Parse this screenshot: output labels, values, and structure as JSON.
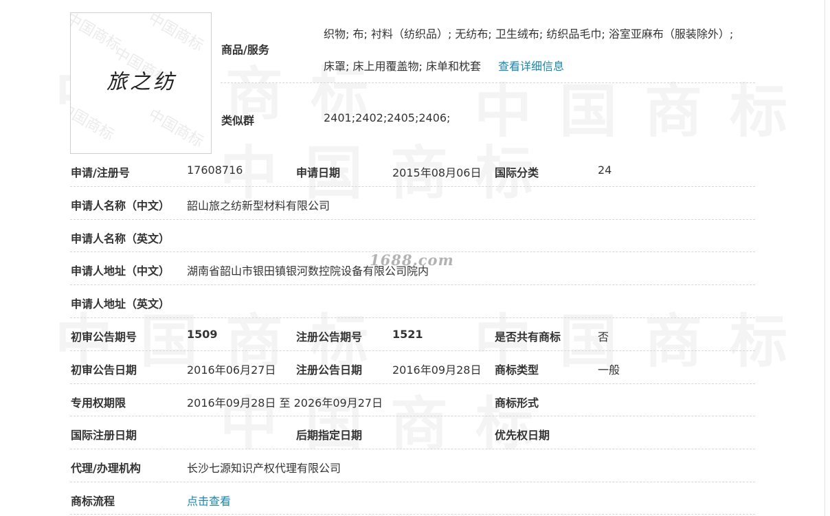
{
  "logo": {
    "mark_text": "旅之纺"
  },
  "goods": {
    "label": "商品/服务",
    "line1": "织物; 布; 衬料（纺织品）; 无纺布; 卫生绒布; 纺织品毛巾; 浴室亚麻布（服装除外）;",
    "line2": "床罩; 床上用覆盖物; 床单和枕套",
    "detail_link": "查看详细信息"
  },
  "similar": {
    "label": "类似群",
    "value": "2401;2402;2405;2406;"
  },
  "rows": {
    "reg_no": {
      "label": "申请/注册号",
      "value": "17608716"
    },
    "apply_date": {
      "label": "申请日期",
      "value": "2015年08月06日"
    },
    "intl_class": {
      "label": "国际分类",
      "value": "24"
    },
    "applicant_cn": {
      "label": "申请人名称（中文）",
      "value": "韶山旅之纺新型材料有限公司"
    },
    "applicant_en": {
      "label": "申请人名称（英文）",
      "value": ""
    },
    "address_cn": {
      "label": "申请人地址（中文）",
      "value": "湖南省韶山市银田镇银河数控院设备有限公司院内"
    },
    "address_en": {
      "label": "申请人地址（英文）",
      "value": ""
    },
    "prelim_issue": {
      "label": "初审公告期号",
      "value": "1509"
    },
    "reg_issue": {
      "label": "注册公告期号",
      "value": "1521"
    },
    "shared": {
      "label": "是否共有商标",
      "value": "否"
    },
    "prelim_date": {
      "label": "初审公告日期",
      "value": "2016年06月27日"
    },
    "reg_date": {
      "label": "注册公告日期",
      "value": "2016年09月28日"
    },
    "tm_type": {
      "label": "商标类型",
      "value": "一般"
    },
    "exclusive": {
      "label": "专用权期限",
      "value": "2016年09月28日 至 2026年09月27日"
    },
    "tm_form": {
      "label": "商标形式",
      "value": ""
    },
    "intl_reg_date": {
      "label": "国际注册日期",
      "value": ""
    },
    "later_date": {
      "label": "后期指定日期",
      "value": ""
    },
    "priority_date": {
      "label": "优先权日期",
      "value": ""
    },
    "agent": {
      "label": "代理/办理机构",
      "value": "长沙七源知识产权代理有限公司"
    },
    "process": {
      "label": "商标流程",
      "link": "点击查看"
    }
  },
  "watermarks": {
    "site": "1688.com",
    "big": "中国商标",
    "logo_tile": "中国商标"
  }
}
